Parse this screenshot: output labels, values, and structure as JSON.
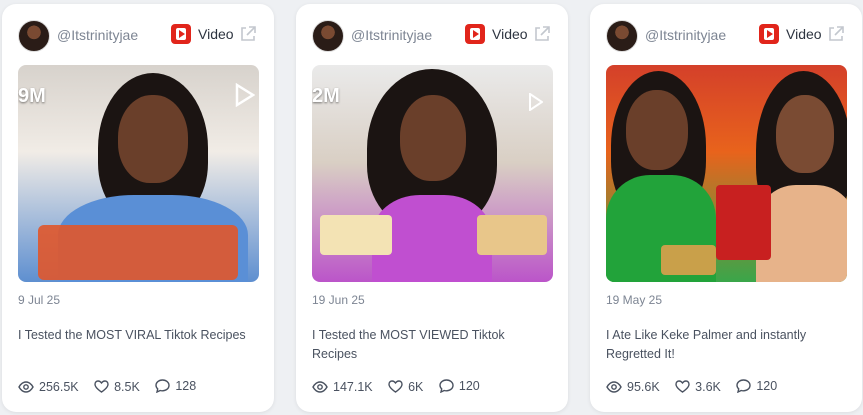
{
  "cards": [
    {
      "handle": "@Itstrinityjae",
      "platform_icon": "youtube-icon",
      "type_label": "Video",
      "thumbnail_overlay": "9M",
      "date": "9 Jul 25",
      "title": "I Tested the MOST VIRAL Tiktok Recipes",
      "views": "256.5K",
      "likes": "8.5K",
      "comments": "128"
    },
    {
      "handle": "@Itstrinityjae",
      "platform_icon": "youtube-icon",
      "type_label": "Video",
      "thumbnail_overlay": "2M",
      "date": "19 Jun 25",
      "title": "I Tested the MOST VIEWED Tiktok Recipes",
      "views": "147.1K",
      "likes": "6K",
      "comments": "120"
    },
    {
      "handle": "@Itstrinityjae",
      "platform_icon": "youtube-icon",
      "type_label": "Video",
      "thumbnail_overlay": "",
      "date": "19 May 25",
      "title": "I Ate Like Keke Palmer and instantly Regretted It!",
      "views": "95.6K",
      "likes": "3.6K",
      "comments": "120"
    }
  ],
  "colors": {
    "youtube_red": "#e1251b",
    "muted_text": "#7d8593",
    "body_text": "#4a5260",
    "card_bg": "#ffffff",
    "page_bg": "#eef0f3"
  }
}
